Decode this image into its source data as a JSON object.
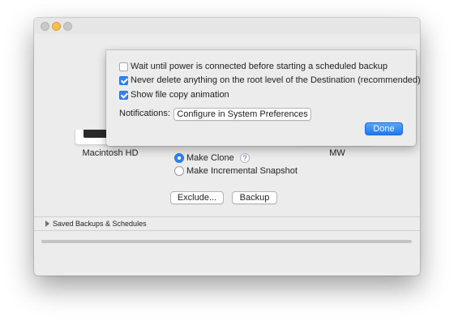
{
  "window": {
    "controls": [
      "close",
      "minimize",
      "zoom"
    ]
  },
  "source": {
    "name": "Macintosh HD",
    "icon": "internal-drive-icon"
  },
  "destination": {
    "name": "MW",
    "icon": "external-drive-icon"
  },
  "mode": {
    "clone_label": "Make Clone",
    "incremental_label": "Make Incremental Snapshot",
    "selected": "Make Clone",
    "help_glyph": "?"
  },
  "actions": {
    "exclude_label": "Exclude...",
    "backup_label": "Backup"
  },
  "saved": {
    "label": "Saved Backups & Schedules",
    "expanded": false
  },
  "progress": {
    "value": 0
  },
  "sheet": {
    "options": [
      {
        "label": "Wait until power is connected before starting a scheduled backup",
        "checked": false
      },
      {
        "label": "Never delete anything on the root level of the Destination (recommended)",
        "checked": true
      },
      {
        "label": "Show file copy animation",
        "checked": true
      }
    ],
    "notifications_label": "Notifications:",
    "configure_label": "Configure in System Preferences",
    "done_label": "Done"
  },
  "colors": {
    "accent": "#2f85f5",
    "window_bg": "#ececec",
    "minimize": "#f5bf4f"
  }
}
